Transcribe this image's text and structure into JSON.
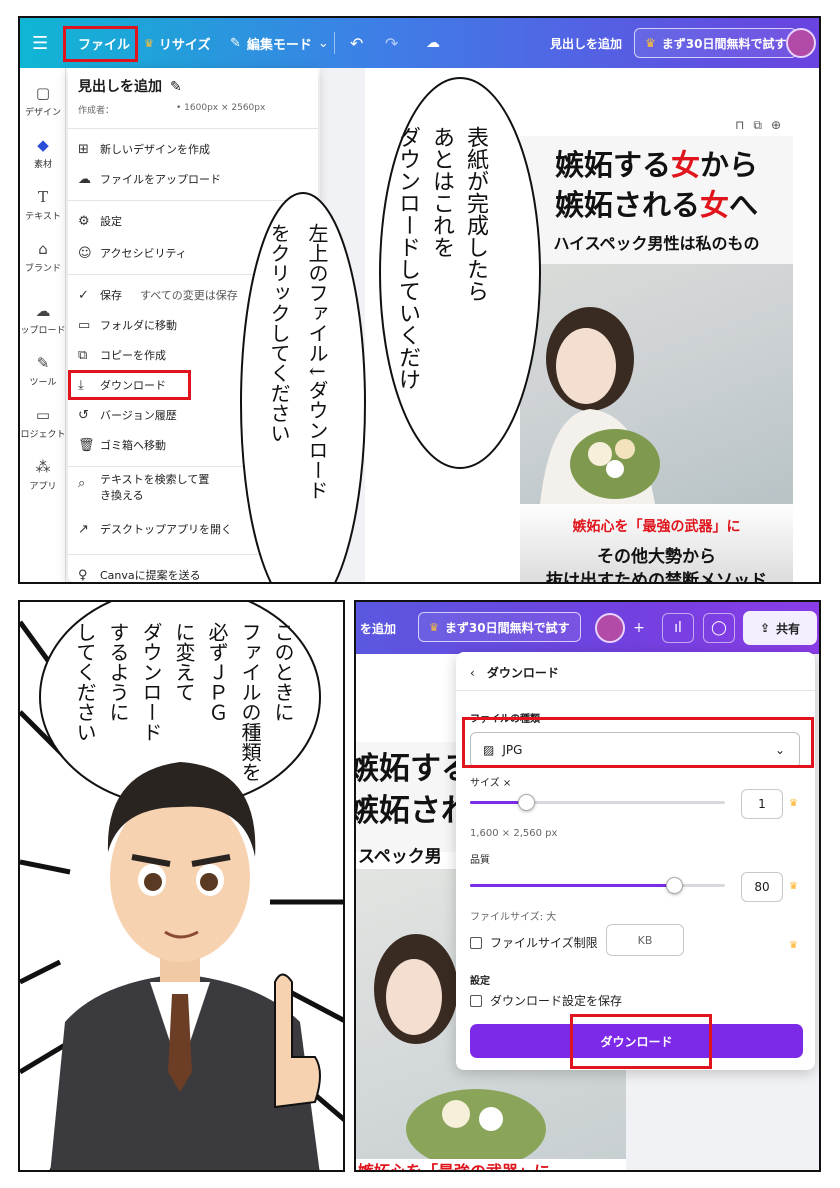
{
  "panel1": {
    "topbar": {
      "menu": "☰",
      "file": "ファイル",
      "resize": "リサイズ",
      "edit_mode": "編集モード",
      "add_heading": "見出しを追加",
      "trial": "まず30日間無料で試す"
    },
    "left_nav": [
      "デザイン",
      "素材",
      "テキスト",
      "ブランド",
      "ップロード",
      "ツール",
      "ロジェクト",
      "アプリ"
    ],
    "file_menu": {
      "title": "見出しを追加",
      "creator_label": "作成者：",
      "size": "• 1600px × 2560px",
      "items": {
        "new_design": "新しいデザインを作成",
        "upload": "ファイルをアップロード",
        "settings": "設定",
        "accessibility": "アクセシビリティ",
        "save": "保存",
        "save_status": "すべての変更は保存",
        "move_folder": "フォルダに移動",
        "copy": "コピーを作成",
        "download": "ダウンロード",
        "version_history": "バージョン履歴",
        "trash": "ゴミ箱へ移動",
        "find_replace_1": "テキストを検索して置",
        "find_replace_2": "き換える",
        "desktop_app": "デスクトップアプリを開く",
        "feedback": "Canvaに提案を送る"
      }
    },
    "design": {
      "headline1_a": "嫉妬する",
      "headline1_b": "女",
      "headline1_c": "から",
      "headline2_a": "嫉妬される",
      "headline2_b": "女",
      "headline2_c": "へ",
      "subtitle": "ハイスペック男性は私のもの",
      "bottom1": "嫉妬心を「最強の武器」に",
      "bottom2": "その他大勢から",
      "bottom3": "抜け出すための禁断メソッド"
    },
    "bubble_right": [
      "表紙が完成したら",
      "あとはこれを",
      "ダウンロードしていくだけ"
    ],
    "bubble_left": [
      "左上のファイル↓ダウンロード",
      "をクリックしてください"
    ]
  },
  "panel2": {
    "bubble": [
      "このときに",
      "ファイルの種類を",
      "必ずＪＰＧ",
      "に変えて",
      "ダウンロード",
      "するように",
      "してください"
    ]
  },
  "panel3": {
    "topbar": {
      "add_heading_partial": "を追加",
      "trial": "まず30日間無料で試す",
      "share": "共有"
    },
    "download_panel": {
      "back_title": "ダウンロード",
      "file_type_label": "ファイルの種類",
      "file_type_value": "JPG",
      "size_label": "サイズ ×",
      "size_value": "1",
      "size_px": "1,600 × 2,560 px",
      "quality_label": "品質",
      "quality_value": "80",
      "file_size": "ファイルサイズ: 大",
      "limit_label": "ファイルサイズ制限",
      "kb": "KB",
      "settings_label": "設定",
      "save_settings": "ダウンロード設定を保存",
      "download_button": "ダウンロード"
    },
    "slider_levels": {
      "size": 0.22,
      "quality": 0.8
    },
    "design_partial": {
      "h1": "嫉妬する",
      "h2": "嫉妬され",
      "sub": "スペック男",
      "bottom": "嫉妬心を「最強の武器」に"
    }
  }
}
